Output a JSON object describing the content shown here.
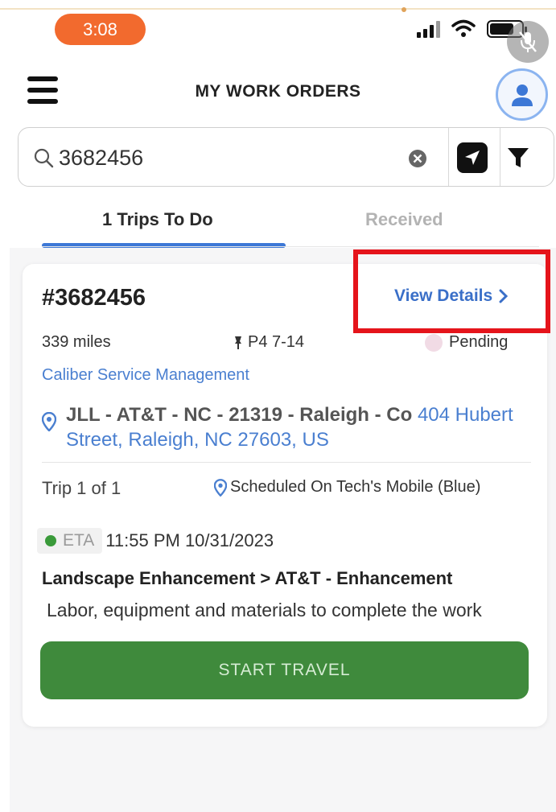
{
  "status_bar": {
    "time": "3:08"
  },
  "header": {
    "title": "MY WORK ORDERS"
  },
  "search": {
    "value": "3682456"
  },
  "tabs": [
    {
      "label": "1 Trips To Do",
      "active": true
    },
    {
      "label": "Received",
      "active": false
    }
  ],
  "work_order": {
    "number": "#3682456",
    "view_details_label": "View Details",
    "miles": "339 miles",
    "priority": "P4 7-14",
    "status": "Pending",
    "company": "Caliber Service Management",
    "site_name": "JLL - AT&T - NC - 21319 - Raleigh - Co",
    "street": "404 Hubert Street, Raleigh, NC 27603, US",
    "trip": "Trip 1 of 1",
    "scheduled": "Scheduled On Tech's Mobile (Blue)",
    "eta_label": "ETA",
    "eta_value": "11:55 PM 10/31/2023",
    "service_title": "Landscape Enhancement > AT&T - Enhancement",
    "service_description": "Labor, equipment and materials to complete the work",
    "start_button_label": "START TRAVEL"
  },
  "colors": {
    "accent_blue": "#3d78d6",
    "link_blue": "#4a7fd0",
    "status_pill": "#f26a2e",
    "start_green": "#3f8a3c",
    "highlight_red": "#e5141b"
  }
}
